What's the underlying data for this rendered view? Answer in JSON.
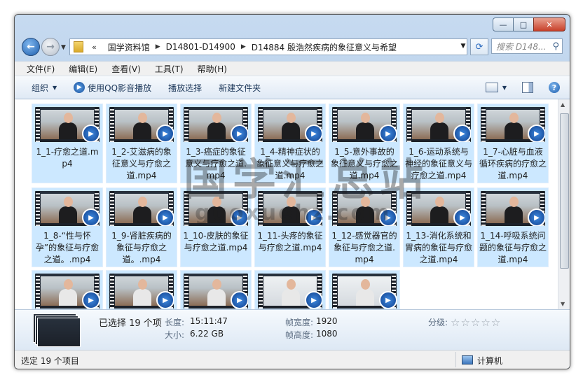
{
  "window": {
    "min": "—",
    "max": "□",
    "close": "✕"
  },
  "nav": {
    "back": "←",
    "forward": "→",
    "breadcrumb_chevron": "«",
    "breadcrumb": [
      "国学资料馆",
      "D14801-D14900",
      "D14884 殷浩然疾病的象征意义与希望"
    ],
    "sep": "▶",
    "search_placeholder": "搜索 D148...",
    "refresh": "⟳"
  },
  "menu": [
    "文件(F)",
    "编辑(E)",
    "查看(V)",
    "工具(T)",
    "帮助(H)"
  ],
  "toolbar": {
    "organize": "组织",
    "play_qq": "使用QQ影音播放",
    "play_selection": "播放选择",
    "new_folder": "新建文件夹",
    "help": "?"
  },
  "files": [
    {
      "name": "1_1-疗愈之道.mp4"
    },
    {
      "name": "1_2-艾滋病的象征意义与疗愈之道.mp4"
    },
    {
      "name": "1_3-癌症的象征意义与疗愈之道.mp4"
    },
    {
      "name": "1_4-精神症状的象征意义与疗愈之道.mp4"
    },
    {
      "name": "1_5-意外事故的象征意义与疗愈之道.mp4"
    },
    {
      "name": "1_6-运动系统与神经的象征意义与疗愈之道.mp4"
    },
    {
      "name": "1_7-心脏与血液循环疾病的疗愈之道.mp4"
    },
    {
      "name": "1_8-“性与怀孕”的象征与疗愈之道。.mp4"
    },
    {
      "name": "1_9-肾脏疾病的象征与疗愈之道。.mp4"
    },
    {
      "name": "1_10-皮肤的象征与疗愈之道.mp4"
    },
    {
      "name": "1_11-头疼的象征与疗愈之道.mp4"
    },
    {
      "name": "1_12-感觉器官的象征与疗愈之道.mp4"
    },
    {
      "name": "1_13-消化系统和胃病的象征与疗愈之道.mp4"
    },
    {
      "name": "1_14-呼吸系统问题的象征与疗愈之道.mp4"
    },
    {
      "name": ""
    },
    {
      "name": ""
    },
    {
      "name": ""
    },
    {
      "name": ""
    },
    {
      "name": ""
    }
  ],
  "details": {
    "selected": "已选择 19 个项",
    "length_label": "长度:",
    "length": "15:11:47",
    "size_label": "大小:",
    "size": "6.22 GB",
    "width_label": "帧宽度:",
    "width": "1920",
    "height_label": "帧高度:",
    "height": "1080",
    "rating_label": "分级:",
    "rating": 0
  },
  "status": {
    "selected": "选定 19 个项目",
    "location": "计算机"
  },
  "watermark": {
    "cn": "国学汇总站",
    "url": "guoxuehz.com"
  }
}
